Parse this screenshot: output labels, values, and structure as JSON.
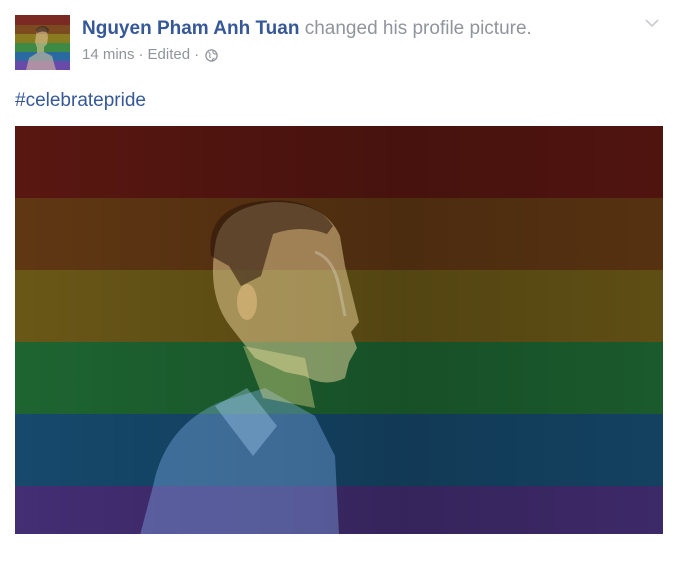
{
  "post": {
    "author": "Nguyen Pham Anh Tuan",
    "action": "changed his profile picture.",
    "time": "14 mins",
    "separator": "·",
    "edited": "Edited",
    "privacy_icon": "globe-icon",
    "menu_icon": "chevron-down-icon",
    "caption": "#celebratepride"
  },
  "photo": {
    "filter": "rainbow-pride-overlay",
    "stripe_colors": [
      "#6b1a1e",
      "#6f3a1c",
      "#7a5e1b",
      "#2d7a3a",
      "#1e5a8a",
      "#5a3d97"
    ]
  },
  "colors": {
    "link": "#365899",
    "meta": "#90949c"
  }
}
